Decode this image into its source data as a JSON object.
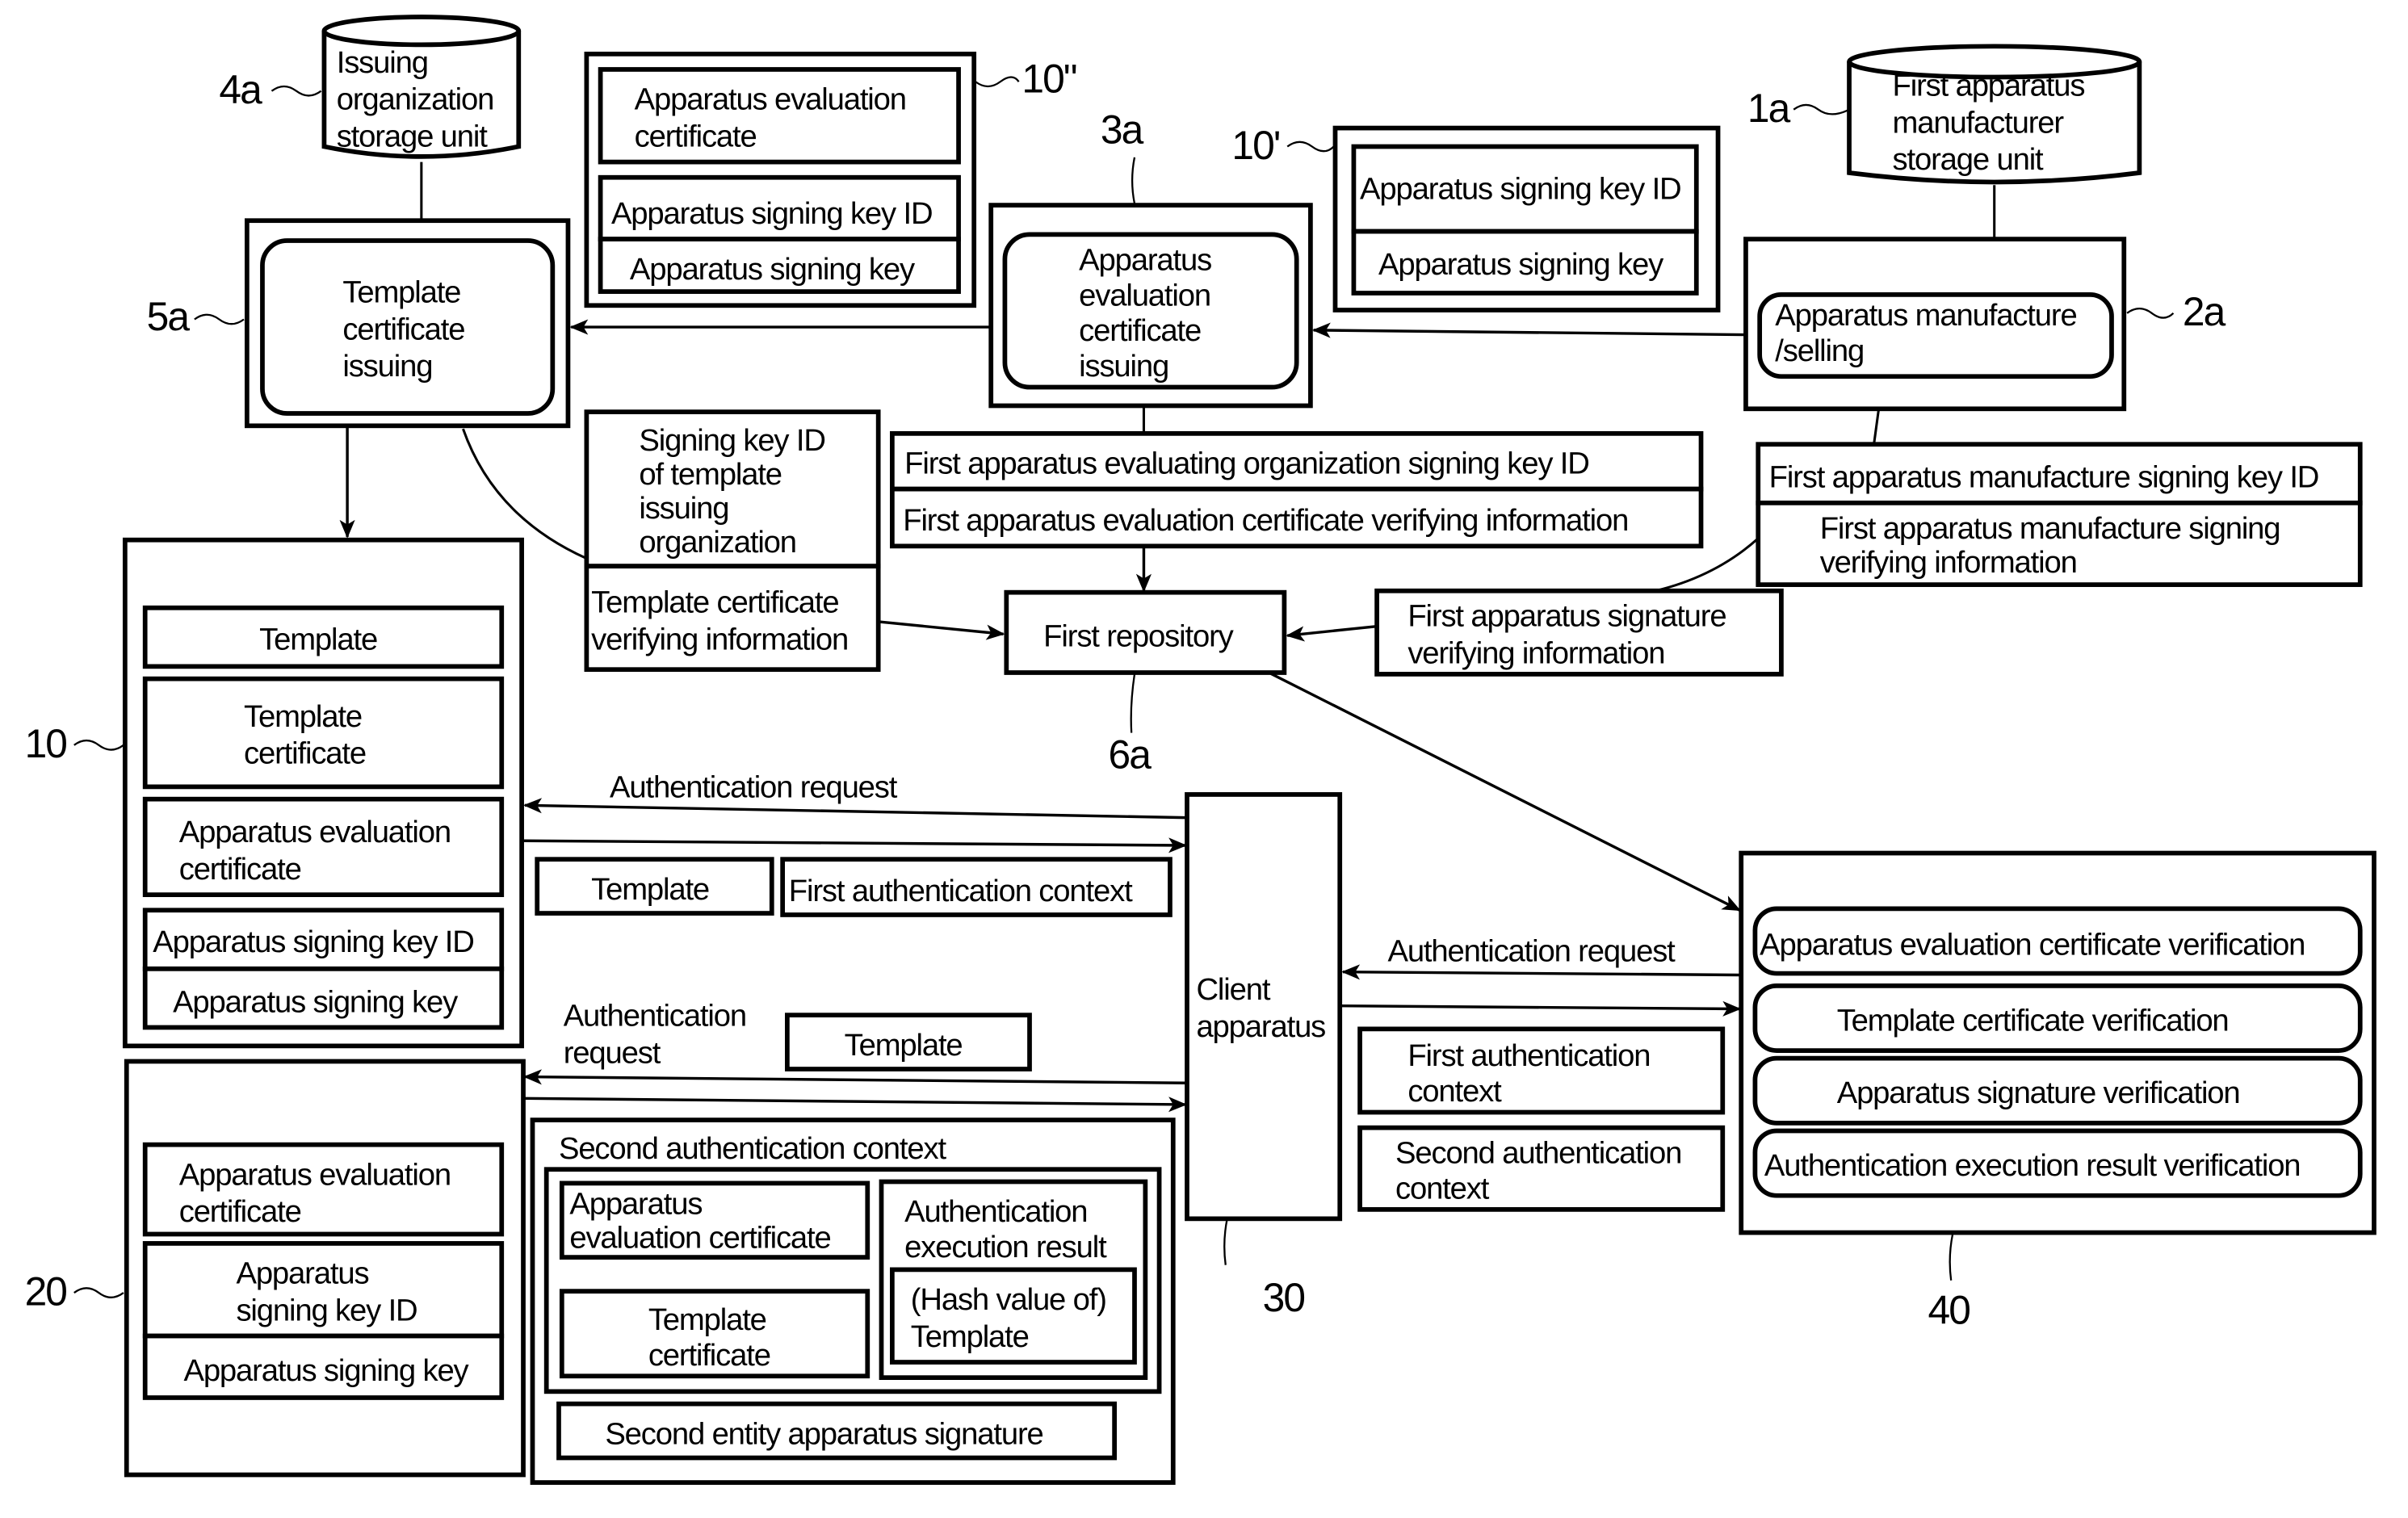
{
  "figure": {
    "reference_labels": {
      "issuing_storage": "4a",
      "template_issuing": "5a",
      "package_10pp": "10\"",
      "eval_issuing": "3a",
      "package_10p": "10'",
      "manufacturer_storage": "1a",
      "manufacture_selling": "2a",
      "repository": "6a",
      "entity_10": "10",
      "entity_20": "20",
      "client": "30",
      "verifier": "40"
    },
    "issuing_org_storage": [
      "Issuing",
      "organization",
      "storage unit"
    ],
    "manufacturer_storage": [
      "First apparatus",
      "manufacturer",
      "storage unit"
    ],
    "template_cert_issuing": [
      "Template",
      "certificate",
      "issuing"
    ],
    "apparatus_eval_cert_issuing": [
      "Apparatus",
      "evaluation",
      "certificate",
      "issuing"
    ],
    "manufacture_selling": [
      "Apparatus manufacture",
      "/selling"
    ],
    "package_10pp": {
      "items": [
        [
          "Apparatus evaluation",
          "certificate"
        ],
        [
          "Apparatus signing key ID"
        ],
        [
          "Apparatus signing key"
        ]
      ]
    },
    "package_10p": {
      "items": [
        "Apparatus signing key ID",
        "Apparatus signing key"
      ]
    },
    "template_org_info": {
      "key_id": [
        "Signing key ID",
        "of template",
        "issuing",
        "organization"
      ],
      "verifying": [
        "Template certificate",
        "verifying information"
      ]
    },
    "eval_org_info": {
      "key_id": "First apparatus evaluating organization signing key ID",
      "verifying": "First apparatus evaluation certificate verifying information"
    },
    "manufacture_info": {
      "key_id": "First apparatus manufacture signing key ID",
      "verifying": [
        "First apparatus manufacture signing",
        "verifying information"
      ]
    },
    "signature_verifying_info": [
      "First apparatus signature",
      "verifying information"
    ],
    "repository": "First repository",
    "entity_10": {
      "items": [
        [
          "Template"
        ],
        [
          "Template",
          "certificate"
        ],
        [
          "Apparatus evaluation",
          "certificate"
        ],
        [
          "Apparatus signing key ID"
        ],
        [
          "Apparatus signing key"
        ]
      ]
    },
    "entity_20": {
      "items": [
        [
          "Apparatus evaluation",
          "certificate"
        ],
        [
          "Apparatus",
          "signing key ID"
        ],
        [
          "Apparatus signing key"
        ]
      ]
    },
    "flow_10": {
      "request": "Authentication request",
      "template": "Template",
      "context": "First authentication context"
    },
    "flow_20": {
      "request": [
        "Authentication",
        "request"
      ],
      "template": "Template"
    },
    "second_context": {
      "title": "Second authentication context",
      "eval_cert": [
        "Apparatus",
        "evaluation certificate"
      ],
      "template_cert": [
        "Template",
        "certificate"
      ],
      "exec_result": [
        "Authentication",
        "execution result"
      ],
      "hash": [
        "(Hash value of)",
        "Template"
      ],
      "signature": "Second entity apparatus signature"
    },
    "client": [
      "Client",
      "apparatus"
    ],
    "flow_40": {
      "request": "Authentication request",
      "first_context": [
        "First authentication",
        "context"
      ],
      "second_context": [
        "Second authentication",
        "context"
      ]
    },
    "verifier": {
      "items": [
        "Apparatus evaluation certificate verification",
        "Template certificate verification",
        "Apparatus signature verification",
        "Authentication execution result verification"
      ]
    }
  }
}
